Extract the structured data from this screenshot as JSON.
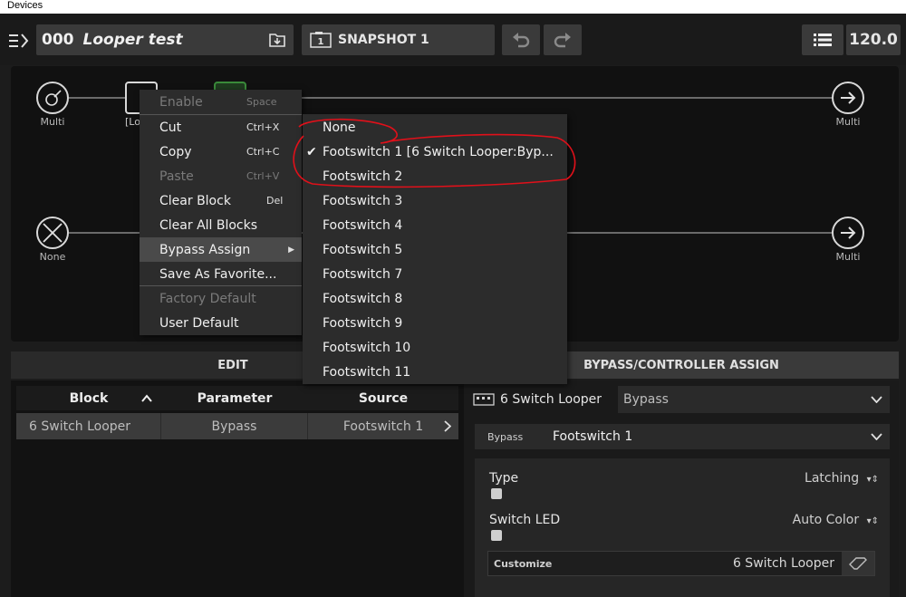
{
  "window": {
    "title": "Devices"
  },
  "toolbar": {
    "preset_number": "000",
    "preset_name": "Looper test",
    "snapshot_label": "SNAPSHOT 1",
    "snapshot_icon_number": "1",
    "tempo": "120.0"
  },
  "chain": {
    "path1_input_label": "Multi",
    "path1_output_label": "Multi",
    "path2_input_label": "None",
    "path2_output_label": "Multi",
    "block_label": "[Lo"
  },
  "context_menu": {
    "items": [
      {
        "label": "Enable",
        "shortcut": "Space",
        "disabled": true
      },
      {
        "label": "Cut",
        "shortcut": "Ctrl+X",
        "disabled": false
      },
      {
        "label": "Copy",
        "shortcut": "Ctrl+C",
        "disabled": false
      },
      {
        "label": "Paste",
        "shortcut": "Ctrl+V",
        "disabled": true
      },
      {
        "label": "Clear Block",
        "shortcut": "Del",
        "disabled": false
      },
      {
        "label": "Clear All Blocks",
        "shortcut": "",
        "disabled": false
      },
      {
        "label": "Bypass Assign",
        "shortcut": "",
        "disabled": false
      },
      {
        "label": "Save As Favorite...",
        "shortcut": "",
        "disabled": false
      },
      {
        "label": "Factory Default",
        "shortcut": "",
        "disabled": true
      },
      {
        "label": "User Default",
        "shortcut": "",
        "disabled": false
      }
    ]
  },
  "submenu": {
    "items": [
      {
        "label": "None",
        "checked": false
      },
      {
        "label": "Footswitch 1 [6 Switch Looper:Byp...",
        "checked": true
      },
      {
        "label": "Footswitch 2",
        "checked": false
      },
      {
        "label": "Footswitch 3",
        "checked": false
      },
      {
        "label": "Footswitch 4",
        "checked": false
      },
      {
        "label": "Footswitch 5",
        "checked": false
      },
      {
        "label": "Footswitch 7",
        "checked": false
      },
      {
        "label": "Footswitch 8",
        "checked": false
      },
      {
        "label": "Footswitch 9",
        "checked": false
      },
      {
        "label": "Footswitch 10",
        "checked": false
      },
      {
        "label": "Footswitch 11",
        "checked": false
      }
    ]
  },
  "tabs": {
    "edit": "EDIT",
    "bypass": "BYPASS/CONTROLLER ASSIGN"
  },
  "table": {
    "headers": [
      "Block",
      "Parameter",
      "Source"
    ],
    "rows": [
      {
        "block": "6 Switch Looper",
        "parameter": "Bypass",
        "source": "Footswitch 1"
      }
    ]
  },
  "assign_panel": {
    "block_name": "6 Switch Looper",
    "parameter": "Bypass",
    "bypass_label": "Bypass",
    "bypass_source": "Footswitch 1",
    "type_label": "Type",
    "type_value": "Latching",
    "led_label": "Switch LED",
    "led_value": "Auto Color",
    "customize_label": "Customize",
    "customize_value": "6 Switch Looper"
  },
  "colors": {
    "annotation": "#e0101a",
    "background": "#1c1c1c"
  }
}
